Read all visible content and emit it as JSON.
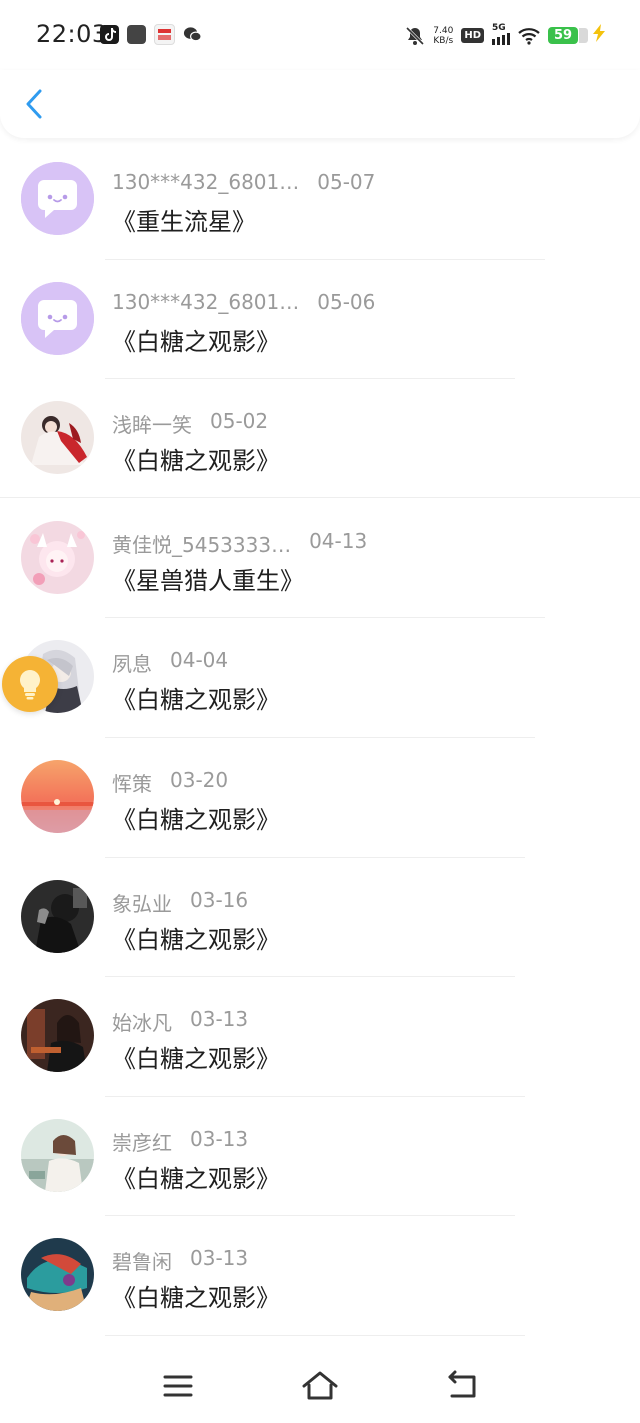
{
  "status_bar": {
    "time": "22:03",
    "net_speed_value": "7.40",
    "net_speed_unit": "KB/s",
    "hd": "HD",
    "network": "5G",
    "battery": "59",
    "news_icon_text": "浏览\n头条",
    "icons_left": [
      "tiktok-icon",
      "app-square-icon",
      "news-icon",
      "wechat-icon"
    ],
    "icons_right": [
      "mute-icon",
      "hd-icon",
      "signal-icon",
      "wifi-icon",
      "battery-icon",
      "charging-icon"
    ]
  },
  "header": {
    "back_icon": "chevron-left-icon",
    "accent_color": "#2f9bef"
  },
  "items": [
    {
      "nick": "130***432_6801…",
      "date": "05-07",
      "title": "《重生流星》",
      "avatar": "default-chat-avatar"
    },
    {
      "nick": "130***432_6801…",
      "date": "05-06",
      "title": "《白糖之观影》",
      "avatar": "default-chat-avatar"
    },
    {
      "nick": "浅眸一笑",
      "date": "05-02",
      "title": "《白糖之观影》",
      "avatar": "anime-red-robe-avatar"
    },
    {
      "nick": "黄佳悦_5453333…",
      "date": "04-13",
      "title": "《星兽猎人重生》",
      "avatar": "anime-pink-girl-avatar"
    },
    {
      "nick": "夙息",
      "date": "04-04",
      "title": "《白糖之观影》",
      "avatar": "anime-white-hair-avatar"
    },
    {
      "nick": "恽策",
      "date": "03-20",
      "title": "《白糖之观影》",
      "avatar": "sunset-avatar"
    },
    {
      "nick": "象弘业",
      "date": "03-16",
      "title": "《白糖之观影》",
      "avatar": "dark-photo-avatar"
    },
    {
      "nick": "始冰凡",
      "date": "03-13",
      "title": "《白糖之观影》",
      "avatar": "girl-photo-avatar"
    },
    {
      "nick": "崇彦红",
      "date": "03-13",
      "title": "《白糖之观影》",
      "avatar": "girl-light-avatar"
    },
    {
      "nick": "碧鲁闲",
      "date": "03-13",
      "title": "《白糖之观影》",
      "avatar": "colorful-art-avatar"
    }
  ],
  "floating_button": {
    "icon": "lightbulb-icon",
    "color": "#f5b335"
  },
  "nav_bar": {
    "icons": [
      "menu-icon",
      "home-icon",
      "back-nav-icon"
    ]
  }
}
